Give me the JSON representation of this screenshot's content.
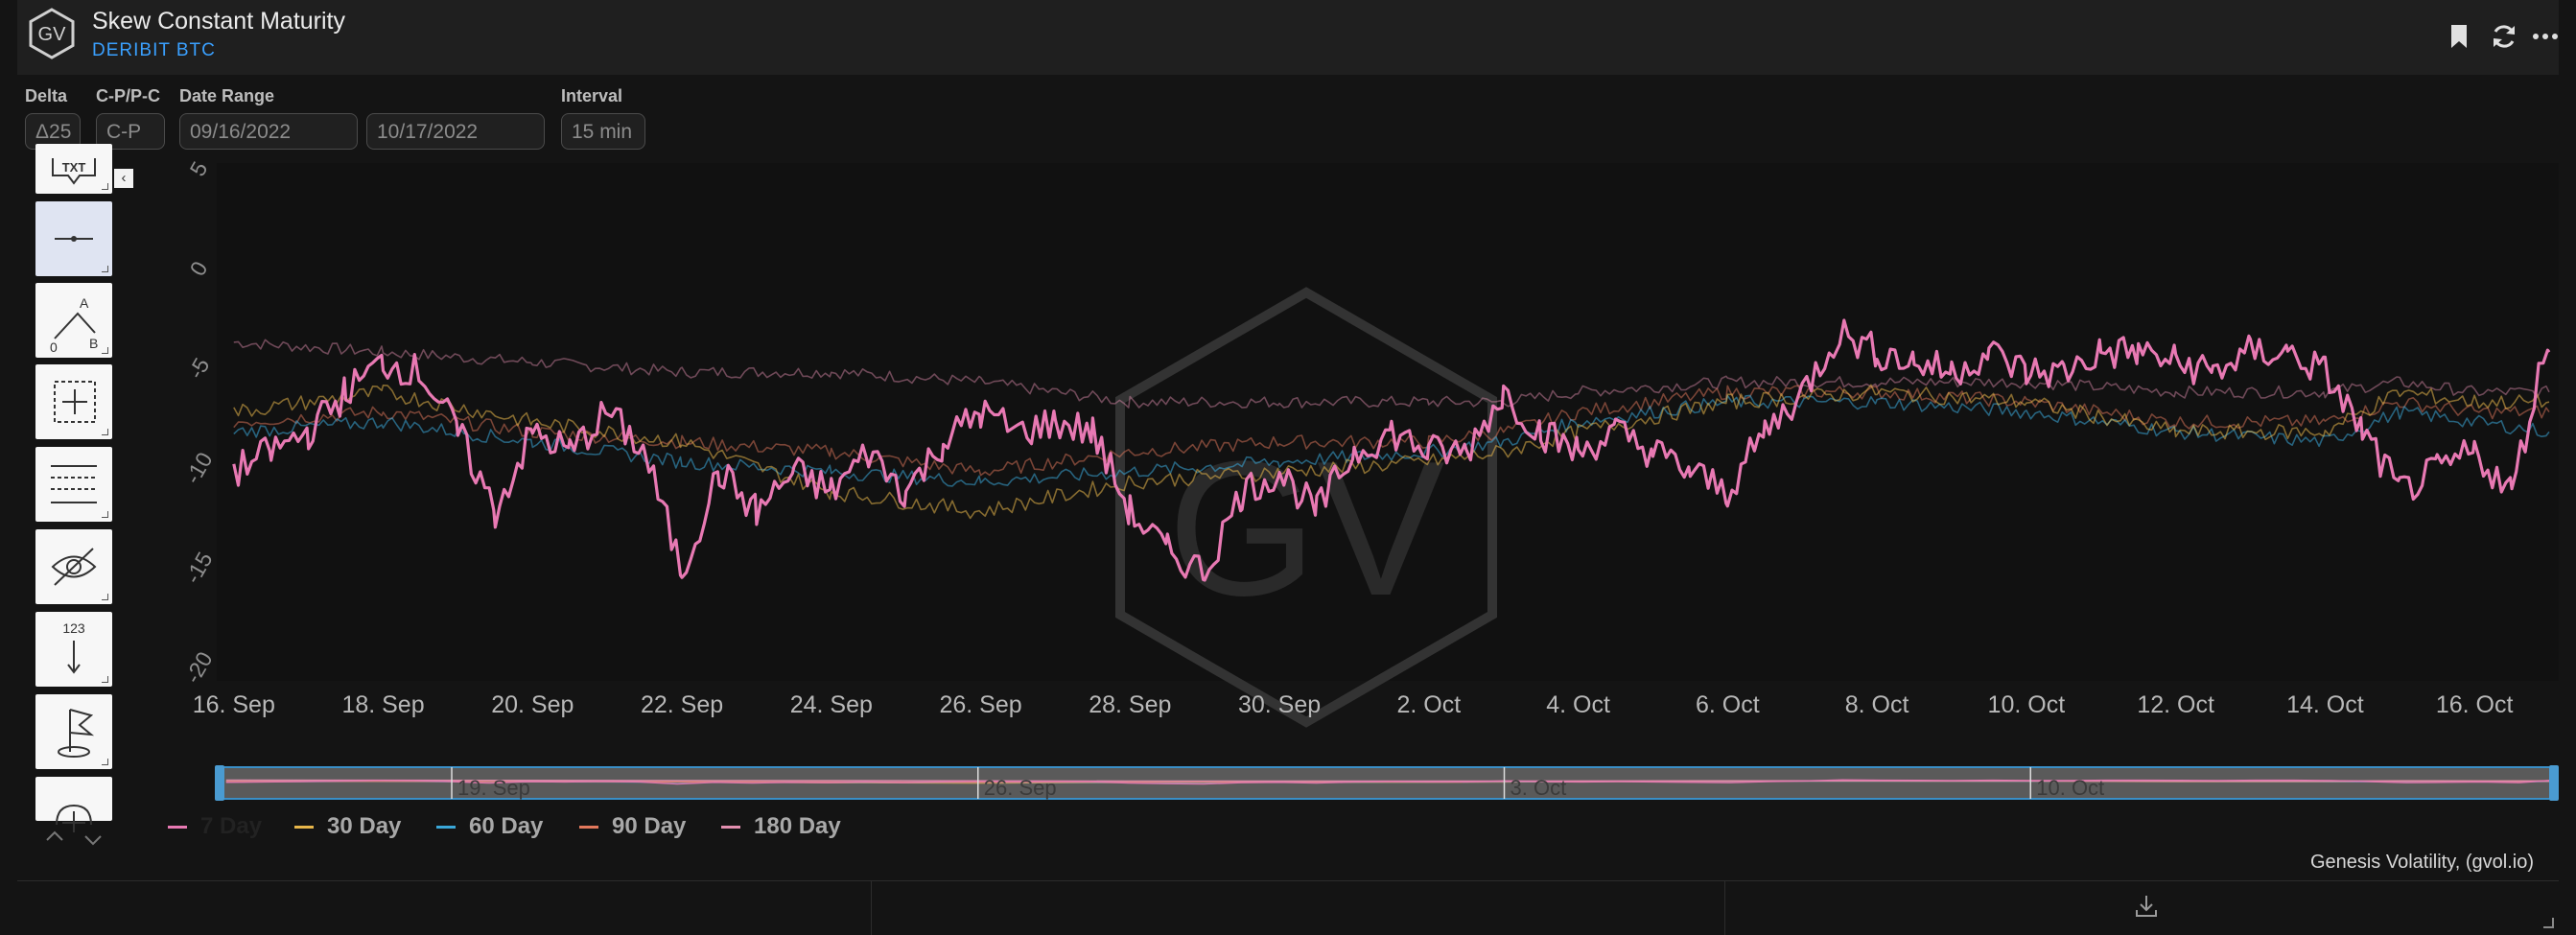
{
  "header": {
    "logo_text": "GV",
    "title": "Skew Constant Maturity",
    "subtitle": "DERIBIT BTC",
    "icons": [
      "bookmark-icon",
      "refresh-icon",
      "more-icon"
    ]
  },
  "controls": {
    "delta_label": "Delta",
    "delta_value": "Δ25",
    "cp_label": "C-P/P-C",
    "cp_value": "C-P",
    "date_range_label": "Date Range",
    "date_start": "09/16/2022",
    "date_end": "10/17/2022",
    "interval_label": "Interval",
    "interval_value": "15 min"
  },
  "toolbar": {
    "tools": [
      "text-tool-icon",
      "line-tool-icon",
      "abc-pattern-icon",
      "crosshair-tool-icon",
      "fibonacci-tool-icon",
      "hide-drawings-icon",
      "measure-tool-icon",
      "flag-tool-icon",
      "magnet-tool-icon"
    ],
    "active_index": 1,
    "top_text_fragment": "TXT"
  },
  "chart_data": {
    "type": "line",
    "ylim": [
      -20,
      5
    ],
    "y_ticks": [
      "5",
      "0",
      "-5",
      "-10",
      "-15",
      "-20"
    ],
    "x_ticks": [
      "16. Sep",
      "18. Sep",
      "20. Sep",
      "22. Sep",
      "24. Sep",
      "26. Sep",
      "28. Sep",
      "30. Sep",
      "2. Oct",
      "4. Oct",
      "6. Oct",
      "8. Oct",
      "10. Oct",
      "12. Oct",
      "14. Oct",
      "16. Oct"
    ],
    "x_tick_days": [
      0,
      2,
      4,
      6,
      8,
      10,
      12,
      14,
      16,
      18,
      20,
      22,
      24,
      26,
      28,
      30
    ],
    "x_range_days": [
      -0.1,
      31.0
    ],
    "grid": false,
    "legend_position": "bottom-left",
    "watermark": "GV",
    "navigator_labels": [
      "19. Sep",
      "26. Sep",
      "3. Oct",
      "10. Oct"
    ],
    "navigator_label_days": [
      3,
      10,
      17,
      24
    ],
    "series": [
      {
        "name": "7 Day",
        "color": "#e879b3",
        "days": [
          0,
          0.5,
          1,
          1.5,
          2,
          2.5,
          3,
          3.5,
          4,
          4.5,
          5,
          5.5,
          6,
          6.5,
          7,
          7.5,
          8,
          8.5,
          9,
          9.5,
          10,
          10.5,
          11,
          11.5,
          12,
          12.5,
          13,
          13.5,
          14,
          14.5,
          15,
          15.5,
          16,
          16.5,
          17,
          17.5,
          18,
          18.5,
          19,
          19.5,
          20,
          20.5,
          21,
          21.5,
          22,
          22.5,
          23,
          23.5,
          24,
          24.5,
          25,
          25.5,
          26,
          26.5,
          27,
          27.5,
          28,
          28.5,
          29,
          29.5,
          30,
          30.5,
          31
        ],
        "values": [
          -10,
          -9,
          -8,
          -6,
          -4.5,
          -5,
          -8,
          -12,
          -8,
          -9,
          -7,
          -9,
          -15,
          -10,
          -12,
          -10,
          -11,
          -9,
          -11,
          -8.5,
          -7,
          -8,
          -7.5,
          -8,
          -12,
          -14,
          -15,
          -11,
          -10,
          -12,
          -9,
          -8,
          -9,
          -9,
          -6,
          -8,
          -9,
          -8,
          -9,
          -10,
          -11,
          -8,
          -6,
          -3,
          -4,
          -4.5,
          -5,
          -4,
          -5,
          -5,
          -4,
          -4,
          -4.5,
          -5,
          -4,
          -4,
          -5,
          -8,
          -11,
          -10,
          -9,
          -11,
          -3,
          -3,
          -2.5,
          -1,
          -3,
          -3,
          -4,
          -4
        ]
      },
      {
        "name": "30 Day",
        "color": "#e7b64a",
        "days": [
          0,
          2,
          4,
          6,
          8,
          10,
          12,
          14,
          16,
          17,
          18,
          20,
          22,
          24,
          26,
          28,
          29,
          30,
          31
        ],
        "values": [
          -7,
          -6,
          -7.5,
          -8.5,
          -11,
          -12,
          -10.5,
          -10,
          -9.5,
          -9,
          -8,
          -6.5,
          -6,
          -6.5,
          -8,
          -8,
          -6,
          -6.5,
          -6.5
        ]
      },
      {
        "name": "60 Day",
        "color": "#3aa7d8",
        "days": [
          0,
          2,
          4,
          6,
          8,
          10,
          12,
          14,
          16,
          17,
          18,
          20,
          22,
          24,
          26,
          28,
          29,
          30,
          31
        ],
        "values": [
          -8,
          -7.5,
          -8.5,
          -9.5,
          -10,
          -10.5,
          -10,
          -9.5,
          -9,
          -8.5,
          -7.5,
          -6.5,
          -6.5,
          -7,
          -8,
          -8.5,
          -7,
          -7.5,
          -8
        ]
      },
      {
        "name": "90 Day",
        "color": "#e2785c",
        "days": [
          0,
          2,
          4,
          6,
          8,
          10,
          12,
          14,
          16,
          17,
          18,
          20,
          22,
          24,
          26,
          28,
          29,
          30,
          31
        ],
        "values": [
          -7.5,
          -7,
          -8,
          -8.5,
          -9,
          -10,
          -9,
          -8.5,
          -8.5,
          -8,
          -7,
          -6,
          -6,
          -6.5,
          -7.5,
          -7.5,
          -6.5,
          -7,
          -7
        ]
      },
      {
        "name": "180 Day",
        "color": "#e38fb0",
        "days": [
          0,
          2,
          4,
          6,
          8,
          10,
          12,
          14,
          16,
          17,
          18,
          20,
          22,
          24,
          26,
          28,
          29,
          30,
          31
        ],
        "values": [
          -3.5,
          -4,
          -4.5,
          -5,
          -5,
          -5.5,
          -6.5,
          -6.5,
          -6.5,
          -6.5,
          -6,
          -5.5,
          -5.5,
          -5.5,
          -6,
          -6,
          -5.5,
          -6,
          -6
        ]
      }
    ]
  },
  "legend": {
    "items": [
      {
        "label": "7 Day",
        "color": "#e879b3"
      },
      {
        "label": "30 Day",
        "color": "#e7b64a"
      },
      {
        "label": "60 Day",
        "color": "#3aa7d8"
      },
      {
        "label": "90 Day",
        "color": "#e2785c"
      },
      {
        "label": "180 Day",
        "color": "#e38fb0"
      }
    ]
  },
  "credit": "Genesis Volatility, (gvol.io)",
  "footer": {
    "icon": "download-icon"
  }
}
